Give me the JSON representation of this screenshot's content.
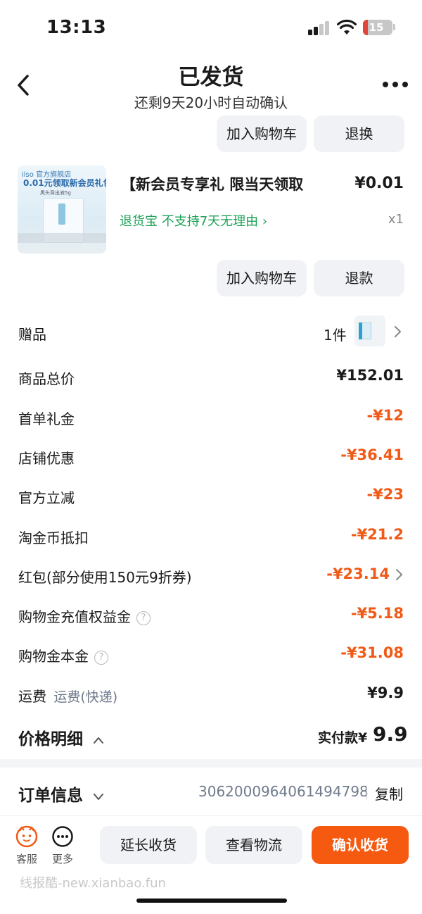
{
  "status_bar": {
    "time": "13:13",
    "battery": "15"
  },
  "header": {
    "title": "已发货",
    "subtitle": "还剩9天20小时自动确认"
  },
  "top_actions": {
    "add_to_cart": "加入购物车",
    "exchange": "退换"
  },
  "product": {
    "image_brand": "ilso 官方旗舰店",
    "image_headline": "0.01元领取新会员礼包",
    "image_caption": "黑头导出液5g",
    "title": "【新会员专享礼 限当天领取",
    "price": "¥0.01",
    "tag": "退货宝  不支持7天无理由 ›",
    "qty": "x1",
    "add_to_cart": "加入购物车",
    "refund": "退款"
  },
  "gift": {
    "label": "赠品",
    "qty": "1件"
  },
  "price_rows": [
    {
      "label": "商品总价",
      "value": "¥152.01"
    },
    {
      "label": "首单礼金",
      "value": "-¥12"
    },
    {
      "label": "店铺优惠",
      "value": "-¥36.41"
    },
    {
      "label": "官方立减",
      "value": "-¥23"
    },
    {
      "label": "淘金币抵扣",
      "value": "-¥21.2"
    },
    {
      "label": "红包(部分使用150元9折券)",
      "value": "-¥23.14"
    },
    {
      "label": "购物金充值权益金",
      "value": "-¥5.18"
    },
    {
      "label": "购物金本金",
      "value": "-¥31.08"
    },
    {
      "label": "运费",
      "note": "运费(快递)",
      "value": "¥9.9"
    }
  ],
  "help_glyph": "?",
  "summary": {
    "label": "价格明细",
    "actual_pay_label": "实付款¥",
    "actual_pay_value": "9.9"
  },
  "order": {
    "label": "订单信息",
    "number": "3062000964061494798",
    "copy": "复制"
  },
  "bottom_bar": {
    "service": "客服",
    "more": "更多",
    "extend": "延长收货",
    "logistics": "查看物流",
    "confirm": "确认收货"
  },
  "watermark": "线报酷-new.xianbao.fun",
  "colors": {
    "accent": "#f05a16",
    "green": "#1fa259",
    "button_bg": "#f0f2f5"
  }
}
